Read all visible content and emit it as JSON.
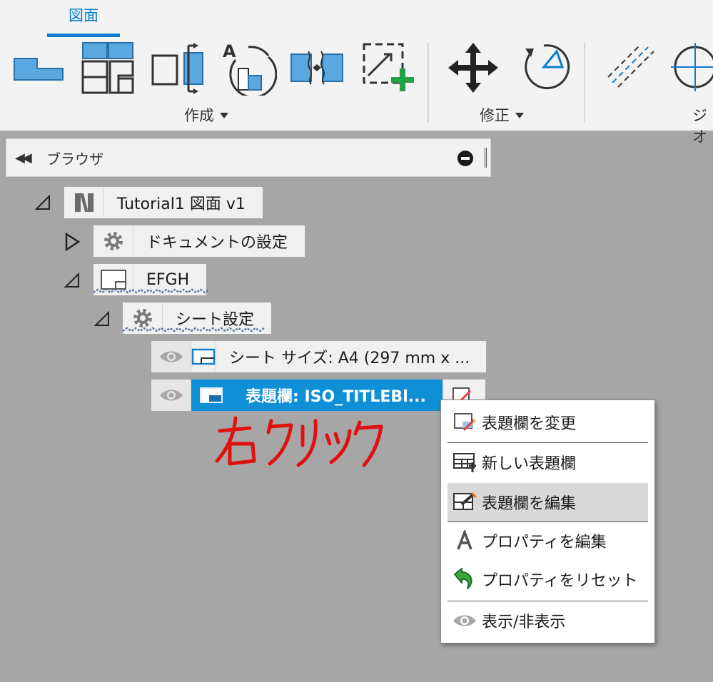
{
  "ribbon": {
    "active_tab": "図面",
    "groups": [
      {
        "label": "作成"
      },
      {
        "label": "修正"
      },
      {
        "label": "ジオ"
      }
    ]
  },
  "browser": {
    "title": "ブラウザ",
    "tree": {
      "root": "Tutorial1 図面 v1",
      "document_settings": "ドキュメントの設定",
      "sheet": "EFGH",
      "sheet_settings": "シート設定",
      "sheet_size": "シート サイズ: A4 (297 mm x ...",
      "title_block": "表題欄: ISO_TITLEBl..."
    }
  },
  "annotation": {
    "text": "右クリック",
    "color": "#e01010"
  },
  "context_menu": {
    "items": [
      {
        "label": "表題欄を変更",
        "icon": "change-title-block-icon"
      },
      {
        "label": "新しい表題欄",
        "icon": "new-title-block-icon"
      },
      {
        "label": "表題欄を編集",
        "icon": "edit-title-block-icon",
        "highlighted": true
      },
      {
        "label": "プロパティを編集",
        "icon": "text-property-icon"
      },
      {
        "label": "プロパティをリセット",
        "icon": "reset-arrow-icon"
      },
      {
        "label": "表示/非表示",
        "icon": "eye-icon"
      }
    ]
  },
  "colors": {
    "accent": "#0a7fcf",
    "selection": "#0f8fd6",
    "canvas": "#a6a6a6"
  }
}
